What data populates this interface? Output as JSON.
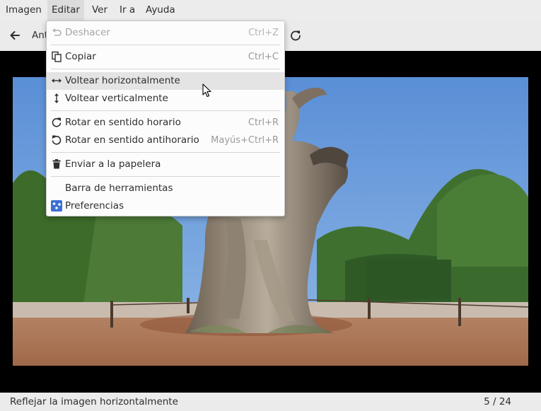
{
  "menubar": {
    "items": [
      {
        "label": "Imagen"
      },
      {
        "label": "Editar"
      },
      {
        "label": "Ver"
      },
      {
        "label": "Ir a"
      },
      {
        "label": "Ayuda"
      }
    ]
  },
  "toolbar": {
    "back_label_partial": "Ant",
    "back_icon": "arrow-left-icon",
    "refresh_icon": "rotate-icon"
  },
  "edit_menu": {
    "undo": {
      "label": "Deshacer",
      "accel": "Ctrl+Z",
      "icon": "undo-icon",
      "disabled": true
    },
    "copy": {
      "label": "Copiar",
      "accel": "Ctrl+C",
      "icon": "copy-icon"
    },
    "flip_h": {
      "label": "Voltear horizontalmente",
      "icon": "flip-horizontal-icon"
    },
    "flip_v": {
      "label": "Voltear verticalmente",
      "icon": "flip-vertical-icon"
    },
    "rotate_cw": {
      "label": "Rotar en sentido horario",
      "accel": "Ctrl+R",
      "icon": "rotate-cw-icon"
    },
    "rotate_ccw": {
      "label": "Rotar en sentido antihorario",
      "accel": "Mayús+Ctrl+R",
      "icon": "rotate-ccw-icon"
    },
    "trash": {
      "label": "Enviar a la papelera",
      "icon": "trash-icon"
    },
    "toolbar": {
      "label": "Barra de herramientas"
    },
    "preferences": {
      "label": "Preferencias",
      "icon": "preferences-icon"
    }
  },
  "statusbar": {
    "message": "Reflejar la imagen horizontalmente",
    "counter": "5 / 24"
  },
  "colors": {
    "accent": "#3b6fd3",
    "menu_hover": "#e4e4e4",
    "viewer_bg": "#000000"
  }
}
